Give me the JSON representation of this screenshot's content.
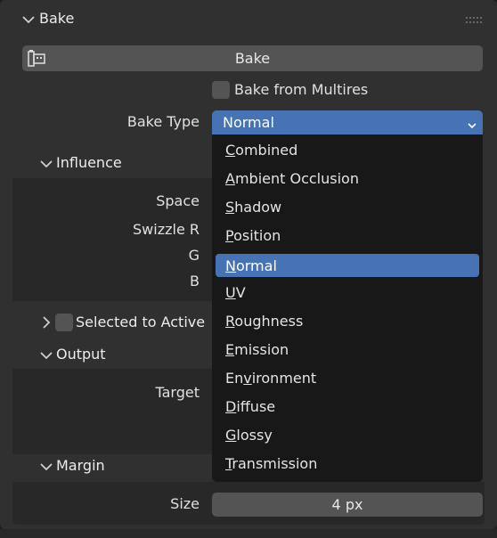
{
  "panel": {
    "title": "Bake",
    "bake_button": "Bake",
    "bake_from_multires": "Bake from Multires",
    "bake_type_label": "Bake Type",
    "bake_type_value": "Normal"
  },
  "influence": {
    "title": "Influence",
    "space_label": "Space",
    "swizzle_r_label": "Swizzle R",
    "g_label": "G",
    "b_label": "B"
  },
  "selected_to_active": {
    "title": "Selected to Active"
  },
  "output": {
    "title": "Output",
    "target_label": "Target"
  },
  "margin": {
    "title": "Margin",
    "size_label": "Size",
    "size_value": "4 px"
  },
  "dropdown": {
    "items": [
      {
        "first": "C",
        "rest": "ombined"
      },
      {
        "first": "A",
        "rest": "mbient Occlusion"
      },
      {
        "first": "S",
        "rest": "hadow"
      },
      {
        "first": "P",
        "rest": "osition"
      },
      {
        "first": "N",
        "rest": "ormal"
      },
      {
        "first": "U",
        "rest": "V"
      },
      {
        "first": "R",
        "rest": "oughness"
      },
      {
        "first": "E",
        "rest": "mission"
      },
      {
        "pre": "En",
        "first": "v",
        "rest": "ironment"
      },
      {
        "first": "D",
        "rest": "iffuse"
      },
      {
        "first": "G",
        "rest": "lossy"
      },
      {
        "first": "T",
        "rest": "ransmission"
      }
    ],
    "selected_index": 4
  },
  "colors": {
    "accent": "#4772b3",
    "panel_bg": "#303030",
    "subpanel_bg": "#282828",
    "widget_bg": "#545454",
    "menu_bg": "#181818"
  }
}
